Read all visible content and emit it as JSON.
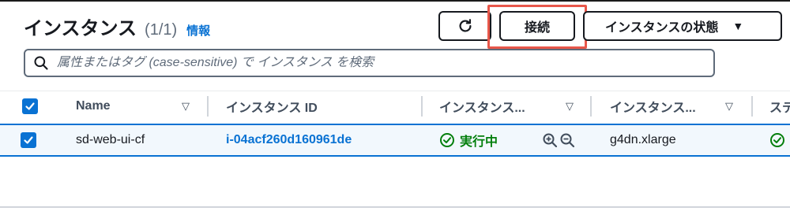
{
  "header": {
    "title": "インスタンス",
    "count": "(1/1)",
    "info_link": "情報"
  },
  "toolbar": {
    "refresh_icon": "refresh-icon",
    "connect_label": "接続",
    "state_label": "インスタンスの状態",
    "state_caret": "▼"
  },
  "search": {
    "placeholder": "属性またはタグ (case-sensitive) で インスタンス を検索"
  },
  "table": {
    "columns": [
      {
        "label": "Name"
      },
      {
        "label": "インスタンス ID"
      },
      {
        "label": "インスタンス..."
      },
      {
        "label": "インスタンス..."
      },
      {
        "label": "ステ"
      }
    ],
    "rows": [
      {
        "selected": true,
        "name": "sd-web-ui-cf",
        "instance_id": "i-04acf260d160961de",
        "state": "実行中",
        "instance_type": "g4dn.xlarge"
      }
    ]
  },
  "colors": {
    "accent": "#0972d3",
    "success": "#037f0c",
    "highlight": "#e8574a"
  }
}
